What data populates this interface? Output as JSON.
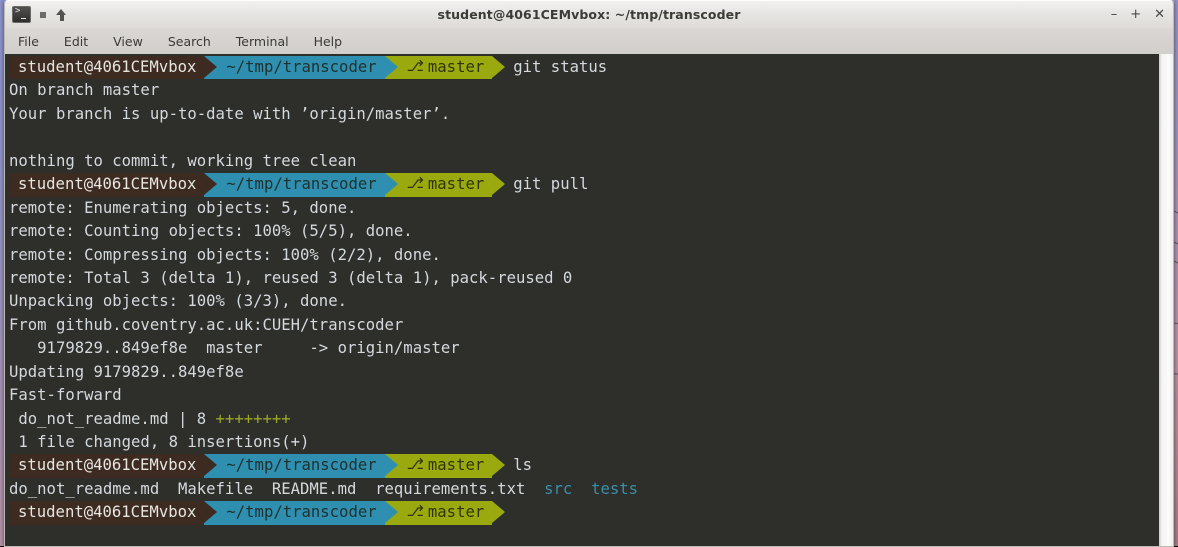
{
  "window": {
    "title": "student@4061CEMvbox: ~/tmp/transcoder",
    "controls": {
      "minimize": "–",
      "maximize": "+",
      "close": "✕"
    },
    "toolbar_icons": [
      "terminal-icon",
      "square-icon",
      "up-arrow-icon"
    ]
  },
  "menubar": {
    "items": [
      {
        "label": "File"
      },
      {
        "label": "Edit"
      },
      {
        "label": "View"
      },
      {
        "label": "Search"
      },
      {
        "label": "Terminal"
      },
      {
        "label": "Help"
      }
    ]
  },
  "prompt": {
    "user_host": "student@4061CEMvbox",
    "path": "~/tmp/transcoder",
    "branch_glyph": "⎇",
    "branch": "master"
  },
  "colors": {
    "terminal_background": "#2e2e2b",
    "terminal_foreground": "#d4d9dd",
    "segment_user_bg": "#3d2b22",
    "segment_path_bg": "#2e8fb0",
    "segment_git_bg": "#9aa90d",
    "diff_add_green": "#9aa825",
    "directory_cyan": "#3a8fa8",
    "titlebar_bg": "#e7e5e3",
    "menubar_bg": "#d4d1cd",
    "scrollbar_bg": "#f6f5f4"
  },
  "terminal": {
    "lines": [
      {
        "kind": "prompt",
        "command": "git status"
      },
      {
        "kind": "text",
        "text": "On branch master"
      },
      {
        "kind": "text",
        "text": "Your branch is up-to-date with ’origin/master’."
      },
      {
        "kind": "text",
        "text": ""
      },
      {
        "kind": "text",
        "text": "nothing to commit, working tree clean"
      },
      {
        "kind": "prompt",
        "command": "git pull"
      },
      {
        "kind": "text",
        "text": "remote: Enumerating objects: 5, done."
      },
      {
        "kind": "text",
        "text": "remote: Counting objects: 100% (5/5), done."
      },
      {
        "kind": "text",
        "text": "remote: Compressing objects: 100% (2/2), done."
      },
      {
        "kind": "text",
        "text": "remote: Total 3 (delta 1), reused 3 (delta 1), pack-reused 0"
      },
      {
        "kind": "text",
        "text": "Unpacking objects: 100% (3/3), done."
      },
      {
        "kind": "text",
        "text": "From github.coventry.ac.uk:CUEH/transcoder"
      },
      {
        "kind": "text",
        "text": "   9179829..849ef8e  master     -> origin/master"
      },
      {
        "kind": "text",
        "text": "Updating 9179829..849ef8e"
      },
      {
        "kind": "text",
        "text": "Fast-forward"
      },
      {
        "kind": "diffstat",
        "file": " do_not_readme.md | 8 ",
        "pluses": "++++++++"
      },
      {
        "kind": "text",
        "text": " 1 file changed, 8 insertions(+)"
      },
      {
        "kind": "prompt",
        "command": "ls"
      },
      {
        "kind": "ls",
        "files": "do_not_readme.md  Makefile  README.md  requirements.txt  ",
        "dirs": "src  tests"
      },
      {
        "kind": "prompt",
        "command": ""
      }
    ]
  }
}
